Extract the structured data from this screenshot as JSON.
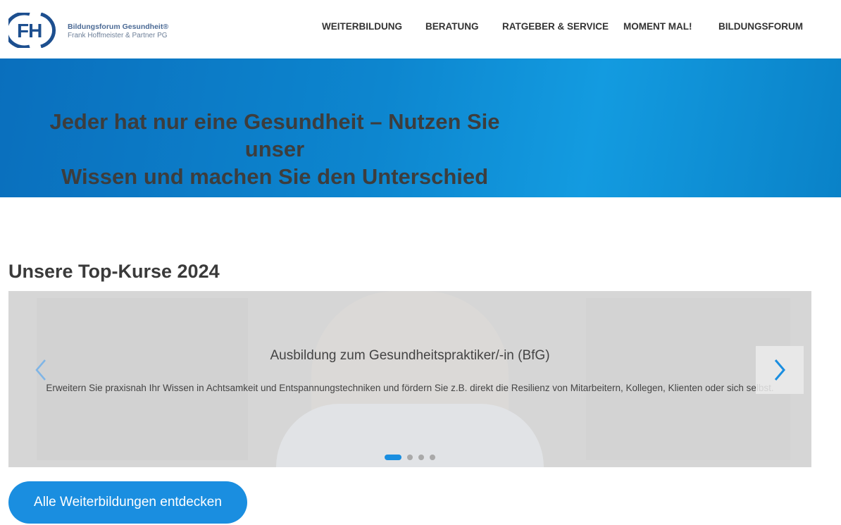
{
  "brand": {
    "logo_initials": "FH",
    "name_line1": "Bildungsforum Gesundheit®",
    "name_line2": "Frank Hoffmeister & Partner PG",
    "color": "#1d4f8f"
  },
  "nav": {
    "items": [
      {
        "label": "WEITERBILDUNG"
      },
      {
        "label": "BERATUNG"
      },
      {
        "label": "RATGEBER & SERVICE"
      },
      {
        "label": "MOMENT MAL!"
      },
      {
        "label": "BILDUNGSFORUM"
      }
    ]
  },
  "hero": {
    "line1": "Jeder hat nur eine Gesundheit – Nutzen Sie unser",
    "line2": "Wissen und machen Sie den Unterschied",
    "color": "#0d86cf"
  },
  "courses": {
    "title": "Unsere Top-Kurse 2024",
    "slide": {
      "title": "Ausbildung zum Gesundheitspraktiker/-in (BfG)",
      "text": "Erweitern Sie praxisnah Ihr Wissen in Achtsamkeit und Entspannungstechniken und fördern Sie z.B. direkt die Resilienz von Mitarbeitern, Kollegen, Klienten oder sich selbst."
    },
    "prev_icon": "chevron-left-icon",
    "next_icon": "chevron-right-icon",
    "slide_count": 4,
    "active_slide": 1
  },
  "cta": {
    "label": "Alle Weiterbildungen entdecken",
    "color": "#1a8ee0"
  }
}
